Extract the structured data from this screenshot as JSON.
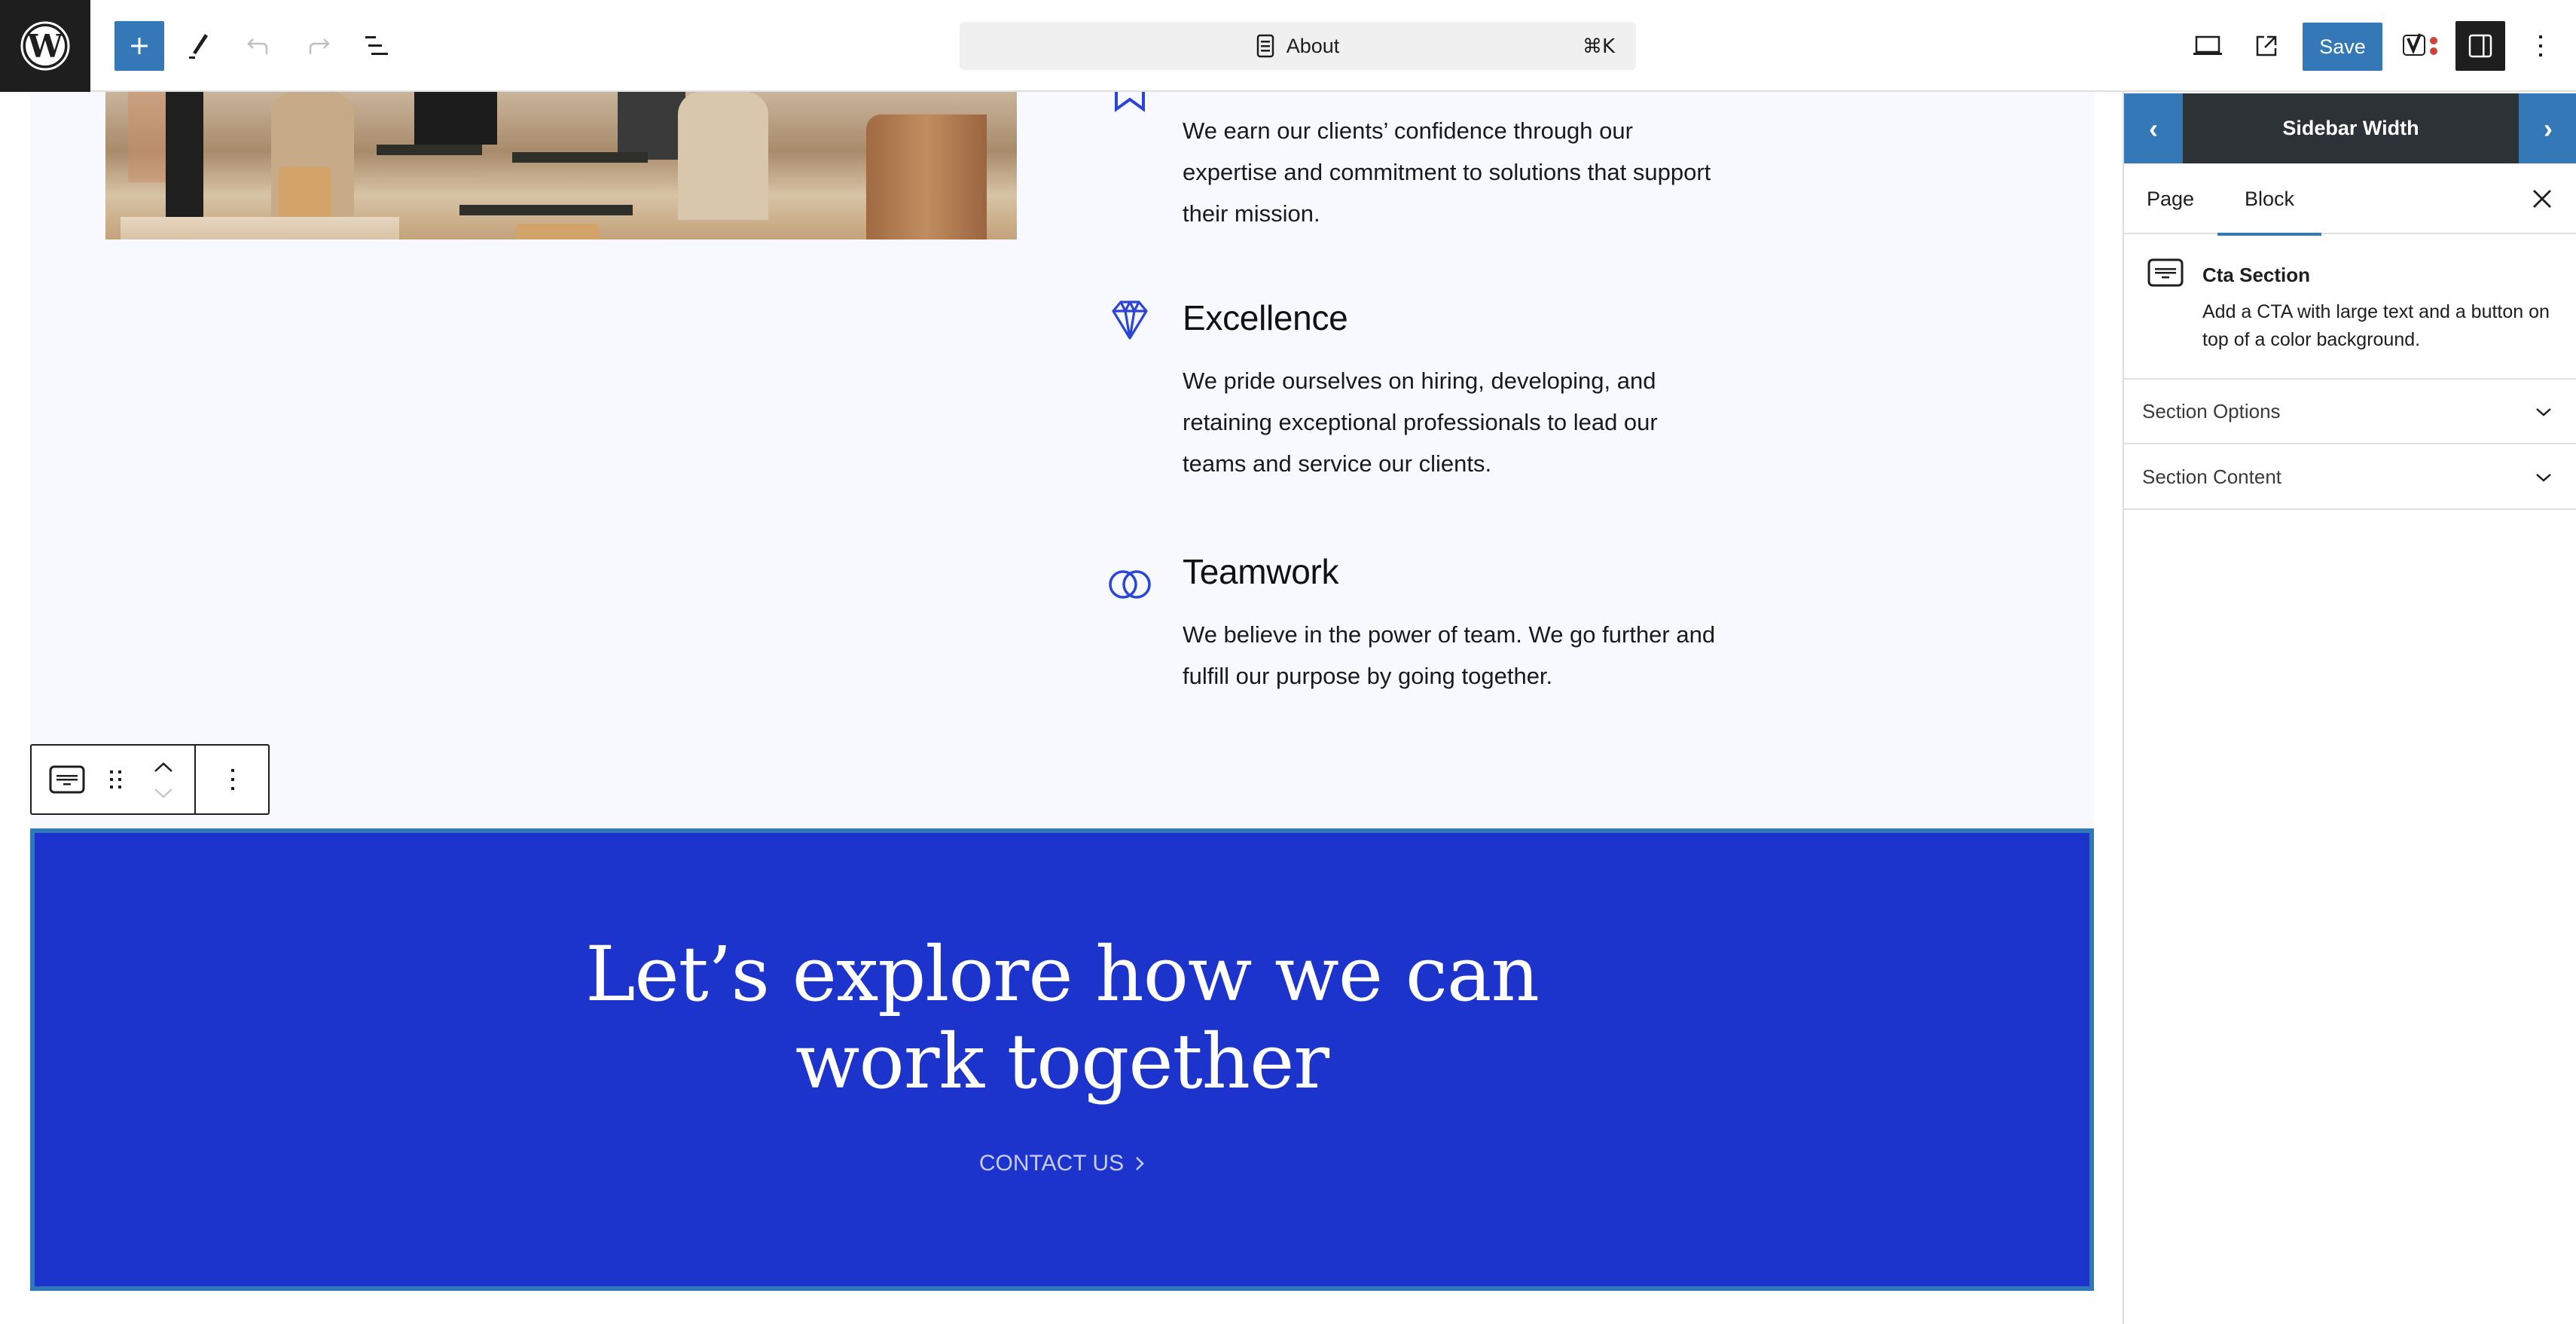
{
  "header": {
    "logo": "wordpress-logo",
    "add_block_icon": "plus-icon",
    "tools_icon": "pencil-icon",
    "undo_icon": "undo-icon",
    "redo_icon": "redo-icon",
    "list_view_icon": "list-view-icon",
    "command_bar": {
      "icon": "page-icon",
      "title": "About",
      "shortcut": "⌘K"
    },
    "view_icon": "laptop-icon",
    "preview_icon": "external-link-icon",
    "save_label": "Save",
    "yoast_icon": "yoast-icon",
    "settings_icon": "sidebar-toggle-icon",
    "options_icon": "more-vertical-icon"
  },
  "canvas": {
    "features": [
      {
        "icon": "star-icon",
        "title": "",
        "text": "We earn our clients’ confidence through our expertise and commitment to solutions that support their mission."
      },
      {
        "icon": "diamond-icon",
        "title": "Excellence",
        "text": "We pride ourselves on hiring, developing, and retaining exceptional professionals to lead our teams and service our clients."
      },
      {
        "icon": "linked-rings-icon",
        "title": "Teamwork",
        "text": "We believe in the power of team. We go further and fulfill our purpose by going together."
      }
    ],
    "block_toolbar": {
      "block_icon": "cta-section-icon",
      "drag_icon": "drag-handle-icon",
      "move_up_icon": "chevron-up-icon",
      "move_down_icon": "chevron-down-icon",
      "options_icon": "more-vertical-icon"
    },
    "cta": {
      "heading_line1": "Let’s explore how we can",
      "heading_line2": "work together",
      "link_label": "CONTACT US",
      "link_icon": "chevron-right-icon",
      "background_color": "#1c34cc"
    }
  },
  "sidebar": {
    "width_bar": {
      "prev": "‹",
      "title": "Sidebar Width",
      "next": "›"
    },
    "tabs": [
      {
        "label": "Page",
        "active": false
      },
      {
        "label": "Block",
        "active": true
      }
    ],
    "close_icon": "close-icon",
    "block_card": {
      "icon": "cta-section-icon",
      "title": "Cta Section",
      "description": "Add a CTA with large text and a button on top of a color background."
    },
    "panels": [
      {
        "label": "Section Options",
        "expanded": false
      },
      {
        "label": "Section Content",
        "expanded": false
      }
    ]
  },
  "colors": {
    "accent": "#3478b8",
    "dark": "#1e1e1e",
    "cta_blue": "#1c34cc",
    "icon_blue": "#2b45d8",
    "canvas_bg": "#f8f9ff"
  }
}
